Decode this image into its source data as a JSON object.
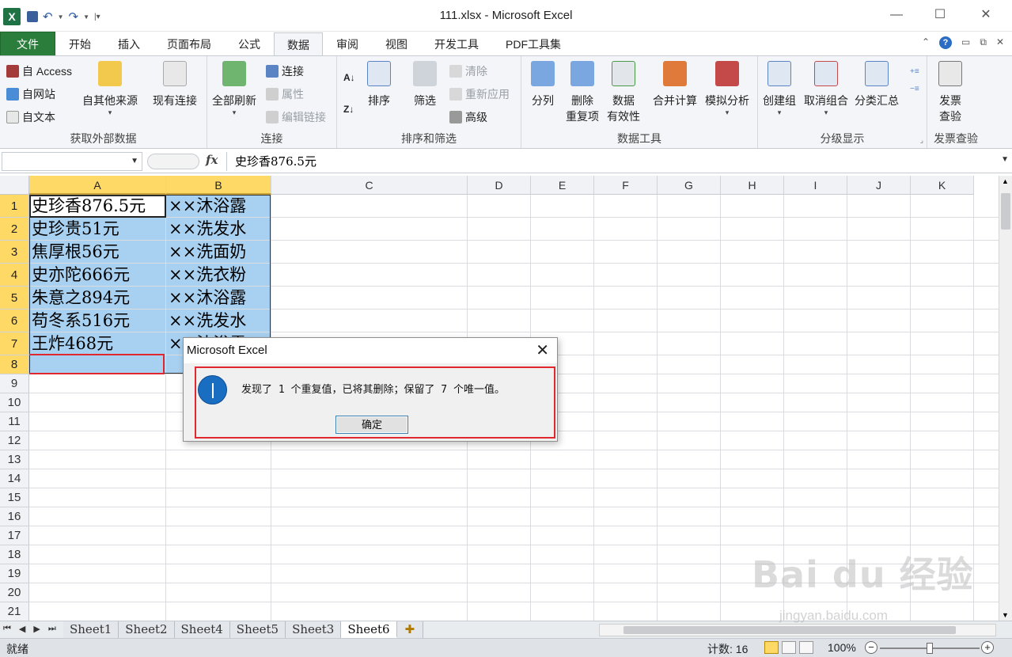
{
  "window": {
    "title": "111.xlsx - Microsoft Excel",
    "app_icon": "excel-logo",
    "minimize": "—",
    "maximize": "☐",
    "close": "✕"
  },
  "tabs": [
    "文件",
    "开始",
    "插入",
    "页面布局",
    "公式",
    "数据",
    "审阅",
    "视图",
    "开发工具",
    "PDF工具集"
  ],
  "active_tab": "数据",
  "ribbon": {
    "external": {
      "label": "获取外部数据",
      "access": "自 Access",
      "web": "自网站",
      "text": "自文本",
      "other": "自其他来源",
      "existing": "现有连接"
    },
    "connections": {
      "label": "连接",
      "refresh_all": "全部刷新",
      "connections": "连接",
      "properties": "属性",
      "edit_links": "编辑链接"
    },
    "sort_filter": {
      "label": "排序和筛选",
      "sort": "排序",
      "filter": "筛选",
      "clear": "清除",
      "reapply": "重新应用",
      "advanced": "高级"
    },
    "data_tools": {
      "label": "数据工具",
      "text_to_columns": "分列",
      "remove_dup_1": "删除",
      "remove_dup_2": "重复项",
      "validation_1": "数据",
      "validation_2": "有效性",
      "consolidate": "合并计算",
      "what_if": "模拟分析"
    },
    "outline": {
      "label": "分级显示",
      "group": "创建组",
      "ungroup": "取消组合",
      "subtotal": "分类汇总"
    },
    "invoice": {
      "label": "发票查验",
      "btn_1": "发票",
      "btn_2": "查验"
    }
  },
  "formula_bar": {
    "name_box": "",
    "fx": "fx",
    "value": "史珍香876.5元"
  },
  "columns": [
    "A",
    "B",
    "C",
    "D",
    "E",
    "F",
    "G",
    "H",
    "I",
    "J",
    "K"
  ],
  "rows": [
    "1",
    "2",
    "3",
    "4",
    "5",
    "6",
    "7",
    "8",
    "9",
    "10",
    "11",
    "12",
    "13",
    "14",
    "15",
    "16",
    "17",
    "18",
    "19",
    "20",
    "21"
  ],
  "cells": [
    [
      "史珍香876.5元",
      "××沐浴露"
    ],
    [
      "史珍贵51元",
      "××洗发水"
    ],
    [
      "焦厚根56元",
      "××洗面奶"
    ],
    [
      "史亦陀666元",
      "××洗衣粉"
    ],
    [
      "朱意之894元",
      "××沐浴露"
    ],
    [
      "苟冬系516元",
      "××洗发水"
    ],
    [
      "王炸468元",
      "××沐浴露"
    ]
  ],
  "sheets": [
    "Sheet1",
    "Sheet2",
    "Sheet4",
    "Sheet5",
    "Sheet3",
    "Sheet6"
  ],
  "active_sheet": "Sheet6",
  "status": {
    "ready": "就绪",
    "count": "计数: 16",
    "zoom": "100%",
    "zoom_minus": "−",
    "zoom_plus": "+"
  },
  "dialog": {
    "title": "Microsoft Excel",
    "message": "发现了 1 个重复值，已将其删除；保留了 7 个唯一值。",
    "ok": "确定",
    "icon": "info-icon"
  },
  "watermark": {
    "main": "Bai du 经验",
    "sub": "jingyan.baidu.com"
  },
  "colors": {
    "file_tab": "#2a7d3b",
    "selection": "#a8d0f0",
    "highlight_header": "#ffd966",
    "red_annotation": "#e0282e",
    "info_blue": "#1a6ec2"
  }
}
